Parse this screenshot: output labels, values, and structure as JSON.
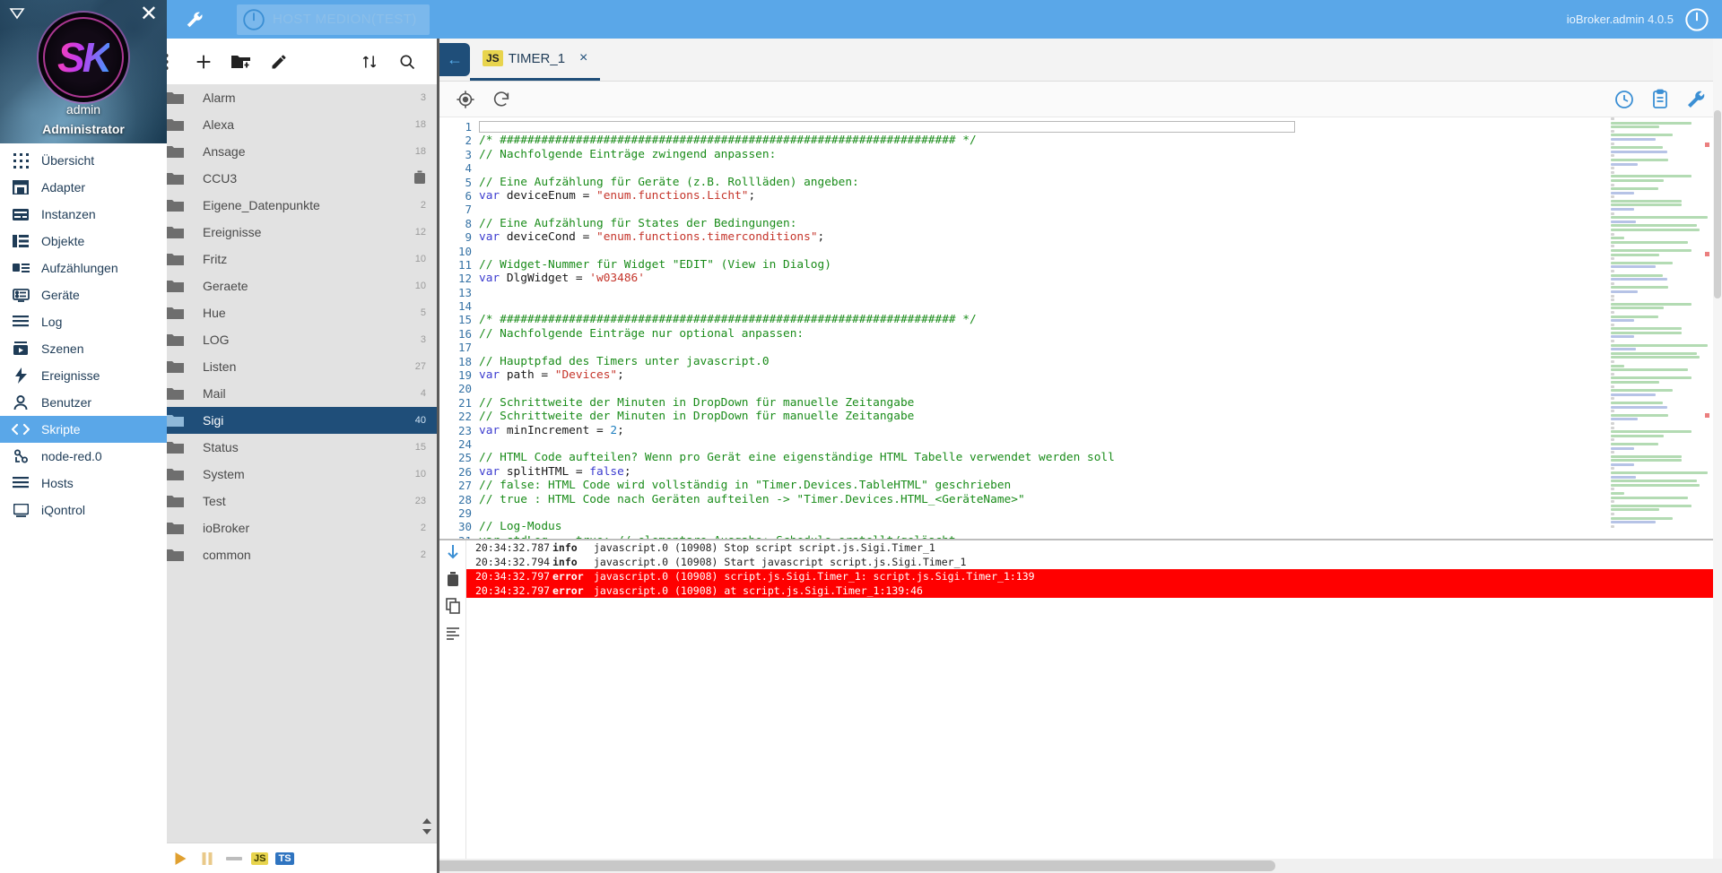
{
  "topbar": {
    "wrench_icon": "wrench-icon",
    "host_label": "HOST MEDION(TEST)",
    "power_icon": "power-icon",
    "version": "ioBroker.admin 4.0.5"
  },
  "profile": {
    "username": "admin",
    "role": "Administrator",
    "logo_text": "SK",
    "close_icon": "close-icon",
    "collapse_icon": "collapse-triangle-icon"
  },
  "sidebar": {
    "items": [
      {
        "label": "Übersicht",
        "icon": "grid-icon",
        "active": false
      },
      {
        "label": "Adapter",
        "icon": "store-icon",
        "active": false
      },
      {
        "label": "Instanzen",
        "icon": "instances-icon",
        "active": false
      },
      {
        "label": "Objekte",
        "icon": "objects-icon",
        "active": false
      },
      {
        "label": "Aufzählungen",
        "icon": "enums-icon",
        "active": false
      },
      {
        "label": "Geräte",
        "icon": "devices-icon",
        "active": false
      },
      {
        "label": "Log",
        "icon": "log-lines-icon",
        "active": false
      },
      {
        "label": "Szenen",
        "icon": "scenes-icon",
        "active": false
      },
      {
        "label": "Ereignisse",
        "icon": "bolt-icon",
        "active": false
      },
      {
        "label": "Benutzer",
        "icon": "user-icon",
        "active": false
      },
      {
        "label": "Skripte",
        "icon": "code-brackets-icon",
        "active": true
      },
      {
        "label": "node-red.0",
        "icon": "node-red-icon",
        "active": false
      },
      {
        "label": "Hosts",
        "icon": "hosts-icon",
        "active": false
      },
      {
        "label": "iQontrol",
        "icon": "iqontrol-icon",
        "active": false
      }
    ]
  },
  "tree_toolbar": {
    "buttons": [
      {
        "name": "more-vert-icon",
        "label": "⋮"
      },
      {
        "name": "add-script-icon",
        "label": "+"
      },
      {
        "name": "add-folder-icon",
        "label": "folder+"
      },
      {
        "name": "edit-icon",
        "label": "pencil"
      }
    ],
    "right_buttons": [
      {
        "name": "expand-collapse-icon",
        "label": "sort"
      },
      {
        "name": "search-icon",
        "label": "search"
      }
    ]
  },
  "tree": {
    "rows": [
      {
        "name": "Alarm",
        "count": "3",
        "expandable": true,
        "selected": false,
        "trash": false
      },
      {
        "name": "Alexa",
        "count": "18",
        "expandable": true,
        "selected": false,
        "trash": false
      },
      {
        "name": "Ansage",
        "count": "18",
        "expandable": true,
        "selected": false,
        "trash": false
      },
      {
        "name": "CCU3",
        "count": "",
        "expandable": false,
        "selected": false,
        "trash": true
      },
      {
        "name": "Eigene_Datenpunkte",
        "count": "2",
        "expandable": true,
        "selected": false,
        "trash": false
      },
      {
        "name": "Ereignisse",
        "count": "12",
        "expandable": true,
        "selected": false,
        "trash": false
      },
      {
        "name": "Fritz",
        "count": "10",
        "expandable": true,
        "selected": false,
        "trash": false
      },
      {
        "name": "Geraete",
        "count": "10",
        "expandable": true,
        "selected": false,
        "trash": false
      },
      {
        "name": "Hue",
        "count": "5",
        "expandable": true,
        "selected": false,
        "trash": false
      },
      {
        "name": "LOG",
        "count": "3",
        "expandable": true,
        "selected": false,
        "trash": false
      },
      {
        "name": "Listen",
        "count": "27",
        "expandable": true,
        "selected": false,
        "trash": false
      },
      {
        "name": "Mail",
        "count": "4",
        "expandable": true,
        "selected": false,
        "trash": false
      },
      {
        "name": "Sigi",
        "count": "40",
        "expandable": false,
        "selected": true,
        "trash": false
      },
      {
        "name": "Status",
        "count": "15",
        "expandable": true,
        "selected": false,
        "trash": false
      },
      {
        "name": "System",
        "count": "10",
        "expandable": true,
        "selected": false,
        "trash": false
      },
      {
        "name": "Test",
        "count": "23",
        "expandable": true,
        "selected": false,
        "trash": false
      },
      {
        "name": "ioBroker",
        "count": "2",
        "expandable": true,
        "selected": false,
        "trash": false
      },
      {
        "name": "common",
        "count": "2",
        "expandable": true,
        "selected": false,
        "trash": false
      }
    ]
  },
  "tree_footer": {
    "pause_icon": "pause-icon",
    "play_icon": "play-icon",
    "pause2_icon": "pause-outline-icon",
    "blockly_icon": "blockly-icon",
    "js_badge": "JS",
    "ts_badge": "TS",
    "resize_icon": "resize-handle-icon"
  },
  "editor": {
    "back_icon": "back-arrow-icon",
    "tab": {
      "badge": "JS",
      "title": "TIMER_1",
      "close": "×"
    },
    "toolbar": {
      "locate_icon": "locate-target-icon",
      "reload_icon": "reload-icon",
      "history_icon": "history-clock-icon",
      "clipboard_icon": "clipboard-icon",
      "settings_icon": "wrench-settings-icon"
    },
    "lines": [
      {
        "n": 1,
        "segs": [
          {
            "t": "cursor",
            "v": ""
          }
        ]
      },
      {
        "n": 2,
        "segs": [
          {
            "t": "cm",
            "v": "/* ################################################################## */"
          }
        ]
      },
      {
        "n": 3,
        "segs": [
          {
            "t": "cm",
            "v": "// Nachfolgende Einträge zwingend anpassen:"
          }
        ]
      },
      {
        "n": 4,
        "segs": []
      },
      {
        "n": 5,
        "segs": [
          {
            "t": "cm",
            "v": "// Eine Aufzählung für Geräte (z.B. Rollläden) angeben:"
          }
        ]
      },
      {
        "n": 6,
        "segs": [
          {
            "t": "kw",
            "v": "var"
          },
          {
            "t": "p",
            "v": " deviceEnum = "
          },
          {
            "t": "str",
            "v": "\"enum.functions.Licht\""
          },
          {
            "t": "p",
            "v": ";"
          }
        ]
      },
      {
        "n": 7,
        "segs": []
      },
      {
        "n": 8,
        "segs": [
          {
            "t": "cm",
            "v": "// Eine Aufzählung für States der Bedingungen:"
          }
        ]
      },
      {
        "n": 9,
        "segs": [
          {
            "t": "kw",
            "v": "var"
          },
          {
            "t": "p",
            "v": " deviceCond = "
          },
          {
            "t": "str",
            "v": "\"enum.functions.timerconditions\""
          },
          {
            "t": "p",
            "v": ";"
          }
        ]
      },
      {
        "n": 10,
        "segs": []
      },
      {
        "n": 11,
        "segs": [
          {
            "t": "cm",
            "v": "// Widget-Nummer für Widget \"EDIT\" (View in Dialog)"
          }
        ]
      },
      {
        "n": 12,
        "segs": [
          {
            "t": "kw",
            "v": "var"
          },
          {
            "t": "p",
            "v": " DlgWidget = "
          },
          {
            "t": "str",
            "v": "'w03486'"
          }
        ]
      },
      {
        "n": 13,
        "segs": []
      },
      {
        "n": 14,
        "segs": []
      },
      {
        "n": 15,
        "segs": [
          {
            "t": "cm",
            "v": "/* ################################################################## */"
          }
        ]
      },
      {
        "n": 16,
        "segs": [
          {
            "t": "cm",
            "v": "// Nachfolgende Einträge nur optional anpassen:"
          }
        ]
      },
      {
        "n": 17,
        "segs": []
      },
      {
        "n": 18,
        "segs": [
          {
            "t": "cm",
            "v": "// Hauptpfad des Timers unter javascript.0"
          }
        ]
      },
      {
        "n": 19,
        "segs": [
          {
            "t": "kw",
            "v": "var"
          },
          {
            "t": "p",
            "v": " path = "
          },
          {
            "t": "str",
            "v": "\"Devices\""
          },
          {
            "t": "p",
            "v": ";"
          }
        ]
      },
      {
        "n": 20,
        "segs": []
      },
      {
        "n": 21,
        "segs": [
          {
            "t": "cm",
            "v": "// Schrittweite der Minuten in DropDown für manuelle Zeitangabe"
          }
        ]
      },
      {
        "n": 22,
        "segs": [
          {
            "t": "cm",
            "v": "// Schrittweite der Minuten in DropDown für manuelle Zeitangabe"
          }
        ]
      },
      {
        "n": 23,
        "segs": [
          {
            "t": "kw",
            "v": "var"
          },
          {
            "t": "p",
            "v": " minIncrement = "
          },
          {
            "t": "num",
            "v": "2"
          },
          {
            "t": "p",
            "v": ";"
          }
        ]
      },
      {
        "n": 24,
        "segs": []
      },
      {
        "n": 25,
        "segs": [
          {
            "t": "cm",
            "v": "// HTML Code aufteilen? Wenn pro Gerät eine eigenständige HTML Tabelle verwendet werden soll"
          }
        ]
      },
      {
        "n": 26,
        "segs": [
          {
            "t": "kw",
            "v": "var"
          },
          {
            "t": "p",
            "v": " splitHTML = "
          },
          {
            "t": "kw",
            "v": "false"
          },
          {
            "t": "p",
            "v": ";"
          }
        ]
      },
      {
        "n": 27,
        "segs": [
          {
            "t": "cm",
            "v": "// false: HTML Code wird vollständig in \"Timer.Devices.TableHTML\" geschrieben"
          }
        ]
      },
      {
        "n": 28,
        "segs": [
          {
            "t": "cm",
            "v": "// true : HTML Code nach Geräten aufteilen -> \"Timer.Devices.HTML_<GeräteName>\""
          }
        ]
      },
      {
        "n": 29,
        "segs": []
      },
      {
        "n": 30,
        "segs": [
          {
            "t": "cm",
            "v": "// Log-Modus"
          }
        ]
      },
      {
        "n": 31,
        "segs": [
          {
            "t": "cm",
            "v": "var stdLog  = true; // elementare Ausgabe: Schedule erstellt/gelöscht"
          }
        ]
      }
    ]
  },
  "console": {
    "side_buttons": [
      {
        "name": "scroll-down-icon"
      },
      {
        "name": "delete-log-icon"
      },
      {
        "name": "copy-log-icon"
      },
      {
        "name": "list-log-icon"
      }
    ],
    "rows": [
      {
        "ts": "20:34:32.787",
        "sev": "info",
        "msg": "javascript.0 (10908) Stop script script.js.Sigi.Timer_1",
        "error": false
      },
      {
        "ts": "20:34:32.794",
        "sev": "info",
        "msg": "javascript.0 (10908) Start javascript script.js.Sigi.Timer_1",
        "error": false
      },
      {
        "ts": "20:34:32.797",
        "sev": "error",
        "msg": "javascript.0 (10908) script.js.Sigi.Timer_1: script.js.Sigi.Timer_1:139",
        "error": true
      },
      {
        "ts": "20:34:32.797",
        "sev": "error",
        "msg": "javascript.0 (10908) at script.js.Sigi.Timer_1:139:46",
        "error": true
      }
    ]
  },
  "colors": {
    "accent": "#5aa7e8",
    "selected_tree": "#1f4e79",
    "error": "#ff0000",
    "comment": "#1a8c1a",
    "string": "#c5352b",
    "keyword": "#3b3bcf"
  }
}
